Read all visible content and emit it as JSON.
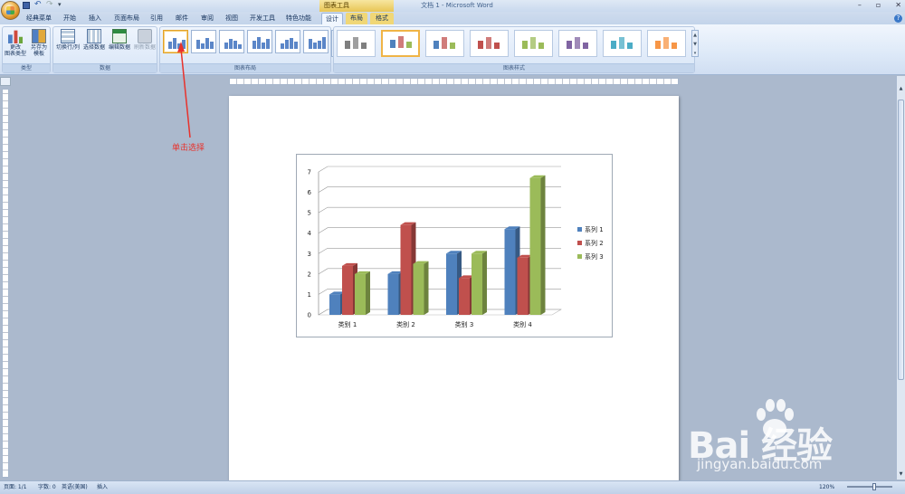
{
  "window": {
    "context_tool_title": "图表工具",
    "doc_title": "文档 1 - Microsoft Word",
    "controls": [
      "–",
      "▫",
      "✕"
    ]
  },
  "tabs": [
    {
      "label": "经典菜单"
    },
    {
      "label": "开始"
    },
    {
      "label": "插入"
    },
    {
      "label": "页面布局"
    },
    {
      "label": "引用"
    },
    {
      "label": "邮件"
    },
    {
      "label": "审阅"
    },
    {
      "label": "视图"
    },
    {
      "label": "开发工具"
    },
    {
      "label": "特色功能"
    },
    {
      "label": "设计"
    },
    {
      "label": "布局"
    },
    {
      "label": "格式"
    }
  ],
  "ribbon": {
    "groups": {
      "type": "类型",
      "data": "数据",
      "layout": "图表布局",
      "styles": "图表样式"
    },
    "buttons": {
      "change_type": [
        "更改",
        "图表类型"
      ],
      "save_template": [
        "另存为",
        "模板"
      ],
      "switch_rowcol": "切换行/列",
      "select_data": "选择数据",
      "edit_data": "编辑数据",
      "refresh_data": "刷新数据"
    },
    "style_colors": [
      "#7f7f7f",
      "#4f81bd",
      "#4f81bd",
      "#c0504d",
      "#9bbb59",
      "#8064a2",
      "#4bacc6",
      "#f79646"
    ]
  },
  "annotation": {
    "text": "单击选择",
    "color": "#e8322c"
  },
  "chart_data": {
    "type": "bar",
    "categories": [
      "类别 1",
      "类别 2",
      "类别 3",
      "类别 4"
    ],
    "series": [
      {
        "name": "系列 1",
        "values": [
          1,
          2,
          3,
          4.2
        ],
        "color": "#4f81bd"
      },
      {
        "name": "系列 2",
        "values": [
          2.4,
          4.4,
          1.8,
          2.8
        ],
        "color": "#c0504d"
      },
      {
        "name": "系列 3",
        "values": [
          2,
          2.5,
          3,
          6.7
        ],
        "color": "#9bbb59"
      }
    ],
    "ylim": [
      0,
      7
    ],
    "yticks": [
      "0",
      "1",
      "2",
      "3",
      "4",
      "5",
      "6",
      "7"
    ],
    "grid": true,
    "legend": "right",
    "style": "3d-clustered-column"
  },
  "status": {
    "page": "页面: 1/1",
    "words": "字数: 0",
    "language": "英语(美国)",
    "mode": "插入",
    "zoom": "120%"
  },
  "watermark": {
    "brand": "Bai  经验",
    "url": "jingyan.baidu.com"
  }
}
